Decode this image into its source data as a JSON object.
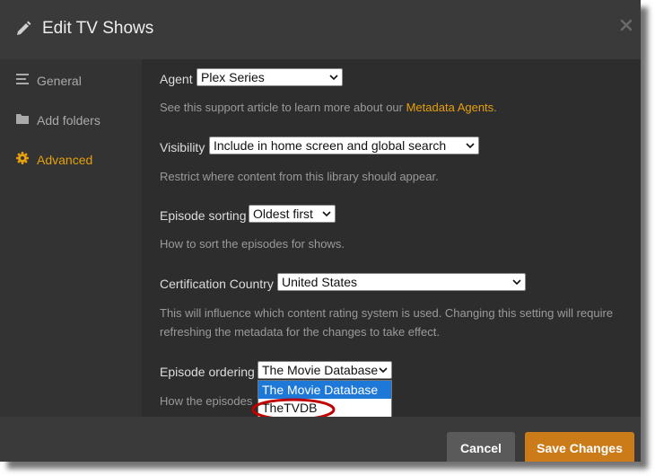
{
  "dialog": {
    "title": "Edit TV Shows"
  },
  "sidebar": {
    "items": [
      {
        "label": "General",
        "icon": "lines-icon",
        "active": false
      },
      {
        "label": "Add folders",
        "icon": "folder-icon",
        "active": false
      },
      {
        "label": "Advanced",
        "icon": "gear-icon",
        "active": true
      }
    ]
  },
  "settings": {
    "agent": {
      "label": "Agent",
      "value": "Plex Series",
      "help_prefix": "See this support article to learn more about our ",
      "help_link": "Metadata Agents",
      "help_suffix": "."
    },
    "visibility": {
      "label": "Visibility",
      "value": "Include in home screen and global search",
      "help": "Restrict where content from this library should appear."
    },
    "episode_sorting": {
      "label": "Episode sorting",
      "value": "Oldest first",
      "help": "How to sort the episodes for shows."
    },
    "certification_country": {
      "label": "Certification Country",
      "value": "United States",
      "help_line1": "This will influence which content rating system is used. Changing this setting will require",
      "help_line2": "refreshing the metadata for the changes to take effect."
    },
    "episode_ordering": {
      "label": "Episode ordering",
      "value": "The Movie Database",
      "help": "How the episodes",
      "options": [
        "The Movie Database",
        "TheTVDB"
      ]
    }
  },
  "footer": {
    "cancel_label": "Cancel",
    "save_label": "Save Changes"
  },
  "colors": {
    "accent": "#e5a00d",
    "save_button": "#cc7b19",
    "selected_option": "#1e78d7",
    "annotation": "#c00000"
  }
}
